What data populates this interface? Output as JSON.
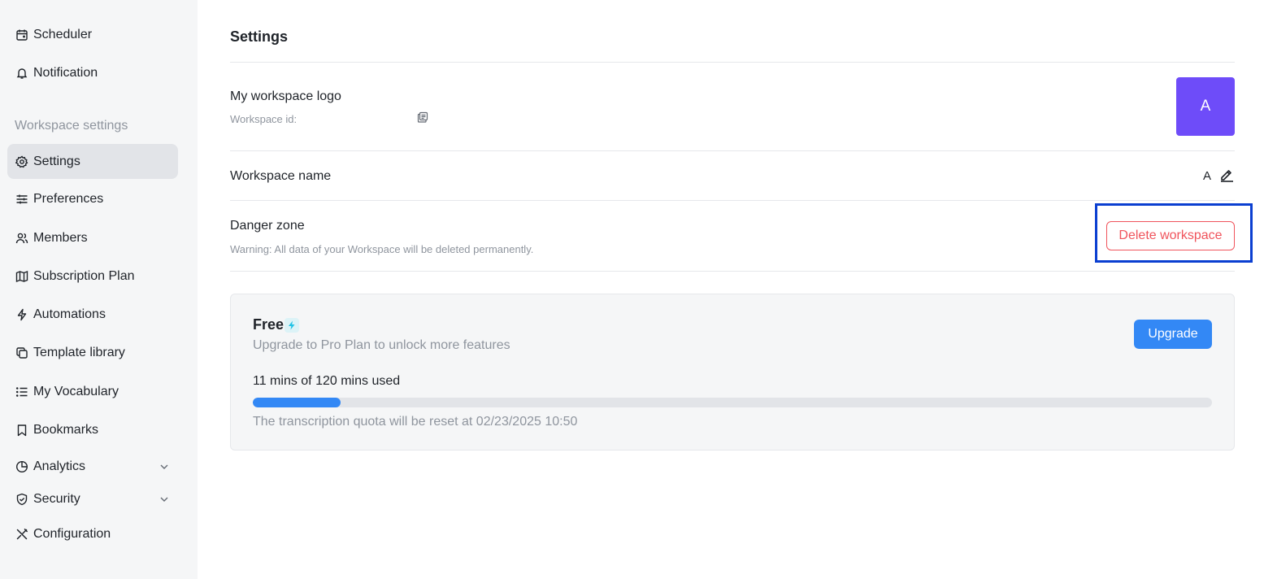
{
  "sidebar": {
    "items_top": [
      {
        "label": "Scheduler",
        "icon": "calendar-icon"
      },
      {
        "label": "Notification",
        "icon": "bell-icon"
      }
    ],
    "section_label": "Workspace settings",
    "items": [
      {
        "label": "Settings",
        "icon": "gear-icon",
        "active": true
      },
      {
        "label": "Preferences",
        "icon": "sliders-icon"
      },
      {
        "label": "Members",
        "icon": "users-icon"
      },
      {
        "label": "Subscription Plan",
        "icon": "map-icon"
      },
      {
        "label": "Automations",
        "icon": "bolt-icon"
      },
      {
        "label": "Template library",
        "icon": "template-icon"
      },
      {
        "label": "My Vocabulary",
        "icon": "list-icon"
      },
      {
        "label": "Bookmarks",
        "icon": "bookmark-icon"
      },
      {
        "label": "Analytics",
        "icon": "pie-chart-icon",
        "expandable": true
      },
      {
        "label": "Security",
        "icon": "shield-icon",
        "expandable": true
      },
      {
        "label": "Configuration",
        "icon": "tools-icon"
      }
    ]
  },
  "main": {
    "title": "Settings",
    "logo": {
      "label": "My workspace logo",
      "workspace_id_label": "Workspace id:",
      "logo_letter": "A",
      "logo_color": "#6e4cf9"
    },
    "workspace_name": {
      "label": "Workspace name",
      "value": "A"
    },
    "danger_zone": {
      "label": "Danger zone",
      "warning": "Warning: All data of your Workspace will be deleted permanently.",
      "delete_button": "Delete workspace"
    },
    "plan": {
      "name": "Free",
      "description": "Upgrade to Pro Plan to unlock more features",
      "upgrade_button": "Upgrade",
      "usage_text": "11 mins of 120 mins used",
      "usage_fraction": 0.0917,
      "reset_text": "The transcription quota will be reset at 02/23/2025 10:50"
    }
  },
  "colors": {
    "accent": "#3388f5",
    "danger": "#f0545c",
    "highlight": "#0b3fd1"
  }
}
